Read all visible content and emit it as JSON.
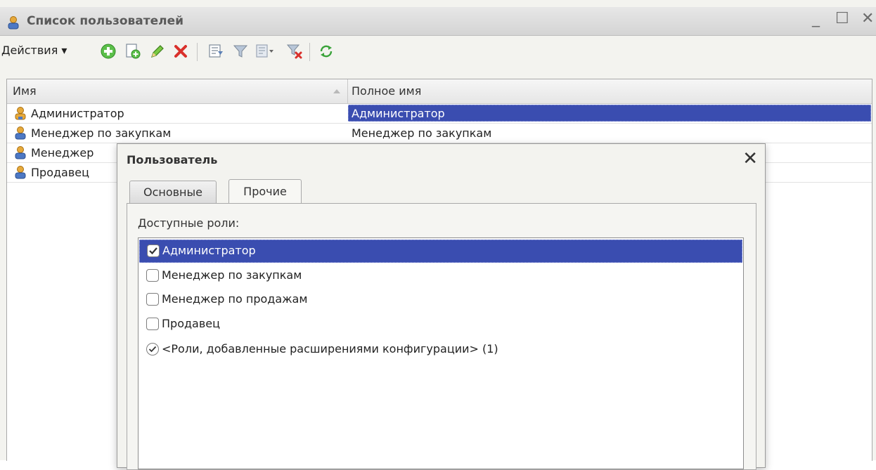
{
  "window": {
    "title": "Список пользователей",
    "controls": [
      "_",
      "☐",
      "✕"
    ]
  },
  "toolbar": {
    "actions_label": "Действия ▾",
    "buttons": [
      "add-icon",
      "copy-icon",
      "edit-icon",
      "delete-icon",
      "filter-settings-icon",
      "filter-icon",
      "filter-dropdown-icon",
      "clear-filter-icon",
      "refresh-icon"
    ]
  },
  "list": {
    "columns": [
      "Имя",
      "Полное имя"
    ],
    "rows": [
      {
        "name": "Администратор",
        "full_name": "Администратор"
      },
      {
        "name": "Менеджер по закупкам",
        "full_name": "Менеджер по закупкам"
      },
      {
        "name": "Менеджер",
        "full_name": ""
      },
      {
        "name": "Продавец",
        "full_name": ""
      }
    ]
  },
  "dialog": {
    "title": "Пользователь",
    "close": "✕",
    "tabs": [
      "Основные",
      "Прочие"
    ],
    "active_tab": "Прочие",
    "roles_label": "Доступные роли:",
    "roles": [
      {
        "label": "Администратор",
        "checked": true,
        "selected": true
      },
      {
        "label": "Менеджер по закупкам",
        "checked": false
      },
      {
        "label": "Менеджер по продажам",
        "checked": false
      },
      {
        "label": "Продавец",
        "checked": false
      },
      {
        "label": "<Роли, добавленные расширениями конфигурации> (1)",
        "checked": true
      }
    ]
  },
  "colors": {
    "selection": "#3a4db0",
    "user_icon": "#e0a43a"
  }
}
